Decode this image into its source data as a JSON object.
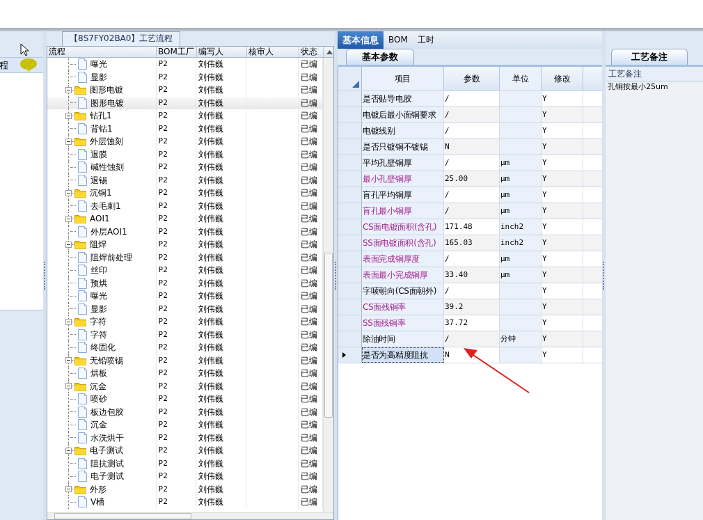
{
  "left_pane": {
    "label": "程"
  },
  "flow_panel": {
    "title": "【8S7FY02BA0】工艺流程",
    "columns": [
      "流程",
      "BOM工厂",
      "编写人",
      "核审人",
      "状态"
    ],
    "tree": {
      "partial_children": [
        {
          "kind": "file",
          "name": "曝光",
          "bom": "P2",
          "writer": "刘伟巍",
          "status": "已编",
          "selected": false
        },
        {
          "kind": "file",
          "name": "显影",
          "bom": "P2",
          "writer": "刘伟巍",
          "status": "已编",
          "selected": false
        }
      ],
      "nodes": [
        {
          "kind": "folder",
          "name": "图形电镀",
          "bom": "P2",
          "writer": "刘伟巍",
          "status": "已编",
          "selected": false,
          "expanded": true,
          "children": [
            {
              "kind": "file",
              "name": "图形电镀",
              "bom": "P2",
              "writer": "刘伟巍",
              "status": "已编",
              "selected": true
            }
          ]
        },
        {
          "kind": "folder",
          "name": "钻孔1",
          "bom": "P2",
          "writer": "刘伟巍",
          "status": "已编",
          "selected": false,
          "expanded": true,
          "children": [
            {
              "kind": "file",
              "name": "背钻1",
              "bom": "P2",
              "writer": "刘伟巍",
              "status": "已编",
              "selected": false
            }
          ]
        },
        {
          "kind": "folder",
          "name": "外层蚀刻",
          "bom": "P2",
          "writer": "刘伟巍",
          "status": "已编",
          "selected": false,
          "expanded": true,
          "children": [
            {
              "kind": "file",
              "name": "退膜",
              "bom": "P2",
              "writer": "刘伟巍",
              "status": "已编",
              "selected": false
            },
            {
              "kind": "file",
              "name": "碱性蚀刻",
              "bom": "P2",
              "writer": "刘伟巍",
              "status": "已编",
              "selected": false
            },
            {
              "kind": "file",
              "name": "退锡",
              "bom": "P2",
              "writer": "刘伟巍",
              "status": "已编",
              "selected": false
            }
          ]
        },
        {
          "kind": "folder",
          "name": "沉铜1",
          "bom": "P2",
          "writer": "刘伟巍",
          "status": "已编",
          "selected": false,
          "expanded": true,
          "children": [
            {
              "kind": "file",
              "name": "去毛刺1",
              "bom": "P2",
              "writer": "刘伟巍",
              "status": "已编",
              "selected": false
            }
          ]
        },
        {
          "kind": "folder",
          "name": "AOI1",
          "bom": "P2",
          "writer": "刘伟巍",
          "status": "已编",
          "selected": false,
          "expanded": true,
          "children": [
            {
              "kind": "file",
              "name": "外层AOI1",
              "bom": "P2",
              "writer": "刘伟巍",
              "status": "已编",
              "selected": false
            }
          ]
        },
        {
          "kind": "folder",
          "name": "阻焊",
          "bom": "P2",
          "writer": "刘伟巍",
          "status": "已编",
          "selected": false,
          "expanded": true,
          "children": [
            {
              "kind": "file",
              "name": "阻焊前处理",
              "bom": "P2",
              "writer": "刘伟巍",
              "status": "已编",
              "selected": false
            },
            {
              "kind": "file",
              "name": "丝印",
              "bom": "P2",
              "writer": "刘伟巍",
              "status": "已编",
              "selected": false
            },
            {
              "kind": "file",
              "name": "预烘",
              "bom": "P2",
              "writer": "刘伟巍",
              "status": "已编",
              "selected": false
            },
            {
              "kind": "file",
              "name": "曝光",
              "bom": "P2",
              "writer": "刘伟巍",
              "status": "已编",
              "selected": false
            },
            {
              "kind": "file",
              "name": "显影",
              "bom": "P2",
              "writer": "刘伟巍",
              "status": "已编",
              "selected": false
            }
          ]
        },
        {
          "kind": "folder",
          "name": "字符",
          "bom": "P2",
          "writer": "刘伟巍",
          "status": "已编",
          "selected": false,
          "expanded": true,
          "children": [
            {
              "kind": "file",
              "name": "字符",
              "bom": "P2",
              "writer": "刘伟巍",
              "status": "已编",
              "selected": false
            },
            {
              "kind": "file",
              "name": "终固化",
              "bom": "P2",
              "writer": "刘伟巍",
              "status": "已编",
              "selected": false
            }
          ]
        },
        {
          "kind": "folder",
          "name": "无铅喷锡",
          "bom": "P2",
          "writer": "刘伟巍",
          "status": "已编",
          "selected": false,
          "expanded": true,
          "children": [
            {
              "kind": "file",
              "name": "烘板",
              "bom": "P2",
              "writer": "刘伟巍",
              "status": "已编",
              "selected": false
            }
          ]
        },
        {
          "kind": "folder",
          "name": "沉金",
          "bom": "P2",
          "writer": "刘伟巍",
          "status": "已编",
          "selected": false,
          "expanded": true,
          "children": [
            {
              "kind": "file",
              "name": "喷砂",
              "bom": "P2",
              "writer": "刘伟巍",
              "status": "已编",
              "selected": false
            },
            {
              "kind": "file",
              "name": "板边包胶",
              "bom": "P2",
              "writer": "刘伟巍",
              "status": "已编",
              "selected": false
            },
            {
              "kind": "file",
              "name": "沉金",
              "bom": "P2",
              "writer": "刘伟巍",
              "status": "已编",
              "selected": false
            },
            {
              "kind": "file",
              "name": "水洗烘干",
              "bom": "P2",
              "writer": "刘伟巍",
              "status": "已编",
              "selected": false
            }
          ]
        },
        {
          "kind": "folder",
          "name": "电子测试",
          "bom": "P2",
          "writer": "刘伟巍",
          "status": "已编",
          "selected": false,
          "expanded": true,
          "children": [
            {
              "kind": "file",
              "name": "阻抗测试",
              "bom": "P2",
              "writer": "刘伟巍",
              "status": "已编",
              "selected": false
            },
            {
              "kind": "file",
              "name": "电子测试",
              "bom": "P2",
              "writer": "刘伟巍",
              "status": "已编",
              "selected": false
            }
          ]
        },
        {
          "kind": "folder",
          "name": "外形",
          "bom": "P2",
          "writer": "刘伟巍",
          "status": "已编",
          "selected": false,
          "expanded": true,
          "children": [
            {
              "kind": "file",
              "name": "V槽",
              "bom": "P2",
              "writer": "刘伟巍",
              "status": "已编",
              "selected": false
            }
          ]
        }
      ]
    }
  },
  "info_panel": {
    "tabs": [
      {
        "label": "基本信息",
        "selected": true
      },
      {
        "label": "BOM",
        "selected": false
      },
      {
        "label": "工时",
        "selected": false
      }
    ],
    "subtab": "基本参数",
    "columns": [
      "项目",
      "参数",
      "单位",
      "修改"
    ],
    "rows": [
      {
        "item": "是否贴导电胶",
        "value": "/",
        "modified": "Y",
        "highlighted": false,
        "current": false
      },
      {
        "item": "电镀后最小面铜要求",
        "value": "/",
        "modified": "Y",
        "highlighted": false,
        "current": false
      },
      {
        "item": "电镀线别",
        "value": "/",
        "modified": "Y",
        "highlighted": false,
        "current": false
      },
      {
        "item": "是否只镀铜不镀锡",
        "value": "N",
        "modified": "Y",
        "highlighted": false,
        "current": false
      },
      {
        "item": "平均孔壁铜厚",
        "value": "/",
        "unit": "μm",
        "modified": "Y",
        "highlighted": false,
        "current": false
      },
      {
        "item": "最小孔壁铜厚",
        "value": "25.00",
        "unit": "μm",
        "modified": "Y",
        "highlighted": true,
        "current": false
      },
      {
        "item": "盲孔平均铜厚",
        "value": "/",
        "unit": "μm",
        "modified": "Y",
        "highlighted": false,
        "current": false
      },
      {
        "item": "盲孔最小铜厚",
        "value": "/",
        "unit": "μm",
        "modified": "Y",
        "highlighted": true,
        "current": false
      },
      {
        "item": "CS面电镀面积(含孔)",
        "value": "171.48",
        "unit": "inch2",
        "modified": "Y",
        "highlighted": true,
        "current": false
      },
      {
        "item": "SS面电镀面积(含孔)",
        "value": "165.03",
        "unit": "inch2",
        "modified": "Y",
        "highlighted": true,
        "current": false
      },
      {
        "item": "表面完成铜厚度",
        "value": "/",
        "unit": "μm",
        "modified": "Y",
        "highlighted": true,
        "current": false
      },
      {
        "item": "表面最小完成铜厚",
        "value": "33.40",
        "unit": "μm",
        "modified": "Y",
        "highlighted": true,
        "current": false
      },
      {
        "item": "字唛朝向(CS面朝外)",
        "value": "/",
        "modified": "Y",
        "highlighted": false,
        "current": false
      },
      {
        "item": "CS面残铜率",
        "value": "39.2",
        "modified": "Y",
        "highlighted": true,
        "current": false
      },
      {
        "item": "SS面残铜率",
        "value": "37.72",
        "modified": "Y",
        "highlighted": true,
        "current": false
      },
      {
        "item": "除油时间",
        "value": "/",
        "unit": "分钟",
        "modified": "Y",
        "highlighted": false,
        "current": false
      },
      {
        "item": "是否为高精度阻抗",
        "value": "N",
        "modified": "Y",
        "highlighted": false,
        "current": true
      }
    ]
  },
  "notes_panel": {
    "tab": "工艺备注",
    "header": "工艺备注",
    "text": "孔铜按最小25um"
  }
}
